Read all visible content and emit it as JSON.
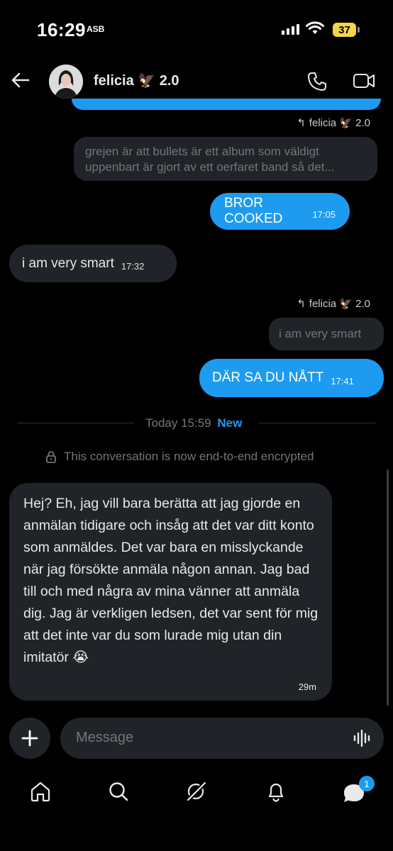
{
  "status": {
    "time": "16:29",
    "extra": "ASB",
    "battery": "37"
  },
  "header": {
    "title": "felicia 🦅 2.0"
  },
  "messages": [
    {
      "reply_to": "felicia 🦅 2.0",
      "quote": "grejen är att bullets är ett album som väldigt uppenbart är gjort av ett oerfaret band så det...",
      "text": "BROR COOKED",
      "time": "17:05",
      "direction": "outgoing"
    },
    {
      "text": "i am very smart",
      "time": "17:32",
      "direction": "incoming"
    },
    {
      "reply_to": "felicia 🦅 2.0",
      "quote": "i am very smart",
      "text": "DÄR SA DU NÅTT",
      "time": "17:41",
      "direction": "outgoing"
    }
  ],
  "day_divider": {
    "label": "Today 15:59",
    "new_label": "New"
  },
  "encryption_notice": "This conversation is now end-to-end encrypted",
  "latest_message": {
    "text": "Hej? Eh, jag vill bara berätta att jag gjorde en anmälan tidigare och insåg att det var ditt konto som anmäldes. Det var bara en misslyckande när jag försökte anmäla någon annan. Jag bad till och med några av mina vänner att anmäla dig. Jag är verkligen ledsen, det var sent för mig att det inte var du som lurade mig utan din imitatör 😭",
    "time": "29m"
  },
  "composer": {
    "placeholder": "Message"
  },
  "nav": {
    "icons": [
      "home-icon",
      "search-icon",
      "grok-icon",
      "notifications-icon",
      "messages-icon"
    ],
    "messages_badge": "1"
  },
  "colors": {
    "accent": "#1d9bf0",
    "bubble_in": "#202327",
    "background": "#000000"
  }
}
